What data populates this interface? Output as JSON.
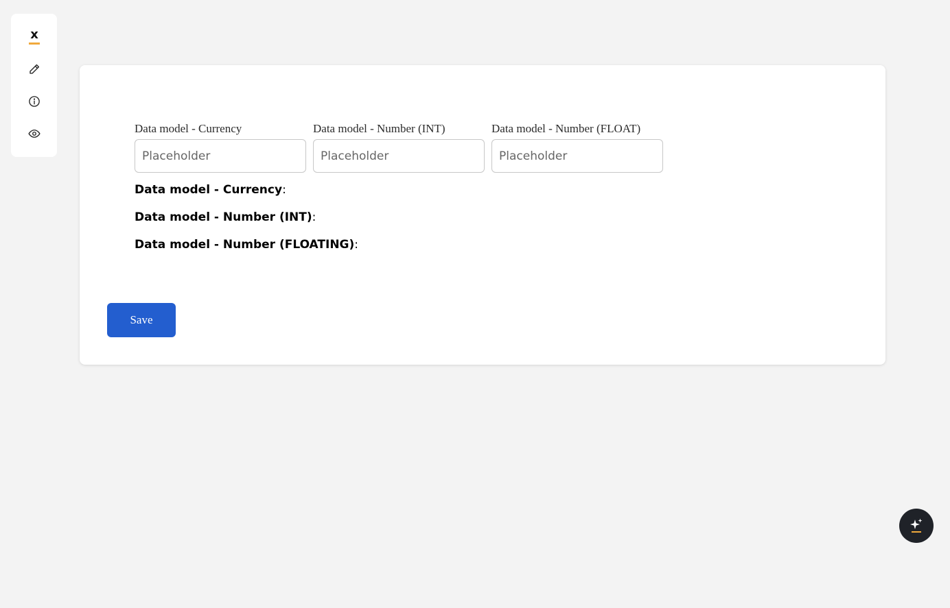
{
  "sidebar": {
    "logo_letter": "x",
    "accent_color": "#f0a93c",
    "items": [
      {
        "icon": "pencil-icon"
      },
      {
        "icon": "info-icon"
      },
      {
        "icon": "eye-icon"
      }
    ]
  },
  "form": {
    "fields": [
      {
        "label": "Data model - Currency",
        "placeholder": "Placeholder",
        "value": ""
      },
      {
        "label": "Data model - Number (INT)",
        "placeholder": "Placeholder",
        "value": ""
      },
      {
        "label": "Data model - Number (FLOAT)",
        "placeholder": "Placeholder",
        "value": ""
      }
    ],
    "outputs": [
      {
        "label": "Data model - Currency",
        "value": ""
      },
      {
        "label": "Data model - Number (INT)",
        "value": ""
      },
      {
        "label": "Data model - Number (FLOATING)",
        "value": ""
      }
    ],
    "save_label": "Save",
    "save_color": "#235ecf"
  },
  "assistant": {
    "icon": "sparkle-icon",
    "background": "#1f2228"
  }
}
